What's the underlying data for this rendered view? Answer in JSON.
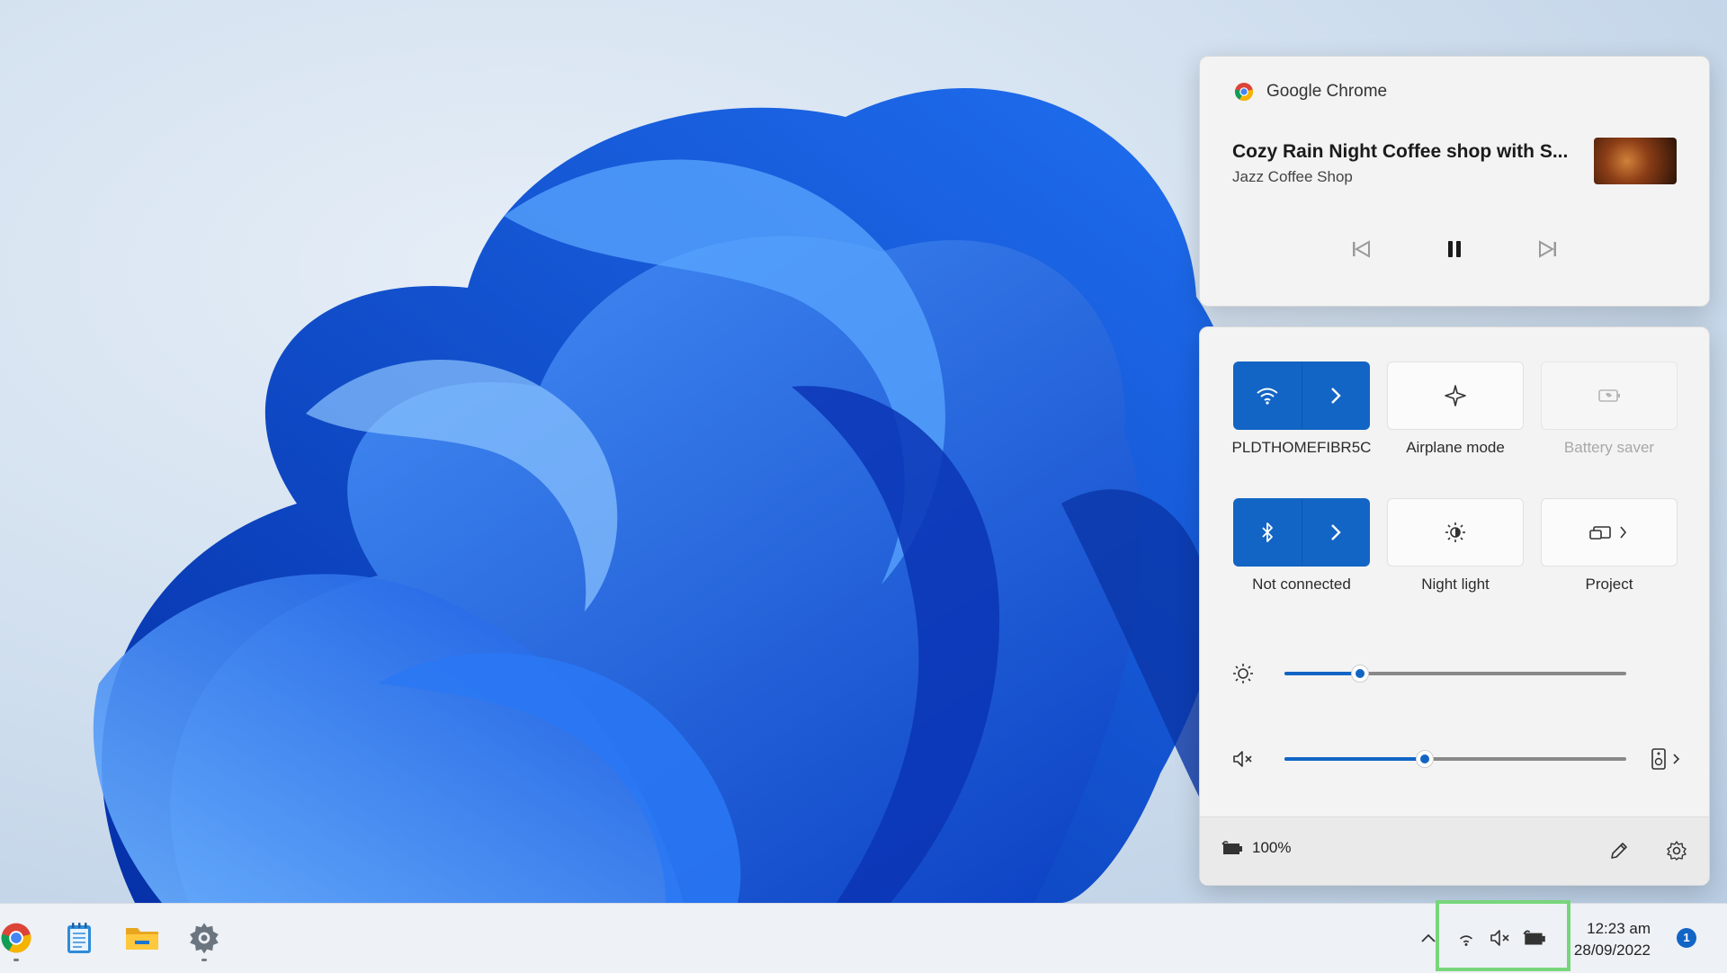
{
  "media": {
    "app_name": "Google Chrome",
    "title": "Cozy Rain Night Coffee shop with S...",
    "artist": "Jazz Coffee Shop",
    "controls": {
      "previous": "previous-track-icon",
      "play_pause": "pause-icon",
      "next": "next-track-icon"
    }
  },
  "quick_settings": {
    "tiles": [
      {
        "label": "PLDTHOMEFIBR5C",
        "icon": "wifi-icon",
        "state": "on",
        "expandable": true
      },
      {
        "label": "Airplane mode",
        "icon": "airplane-icon",
        "state": "off"
      },
      {
        "label": "Battery saver",
        "icon": "battery-saver-icon",
        "state": "disabled"
      },
      {
        "label": "Not connected",
        "icon": "bluetooth-icon",
        "state": "on",
        "expandable": true
      },
      {
        "label": "Night light",
        "icon": "night-light-icon",
        "state": "off"
      },
      {
        "label": "Project",
        "icon": "project-icon",
        "state": "off",
        "expandable": true
      }
    ],
    "brightness": {
      "icon": "brightness-icon",
      "level": 0.22
    },
    "volume": {
      "icon": "speaker-muted-icon",
      "level": 0.41,
      "output_icon": "speaker-device-icon"
    },
    "battery_text": "100%",
    "footer_icons": [
      "battery-icon",
      "edit-icon",
      "settings-icon"
    ]
  },
  "taskbar": {
    "apps": [
      "chrome-icon",
      "notepad-icon",
      "file-explorer-icon",
      "settings-gear-icon"
    ],
    "tray": [
      "chevron-up-icon",
      "wifi-icon",
      "speaker-muted-icon",
      "battery-icon"
    ],
    "time": "12:23 am",
    "date": "28/09/2022",
    "notification_count": "1"
  },
  "colors": {
    "accent": "#1265c5",
    "tray_highlight": "#78d67a"
  }
}
